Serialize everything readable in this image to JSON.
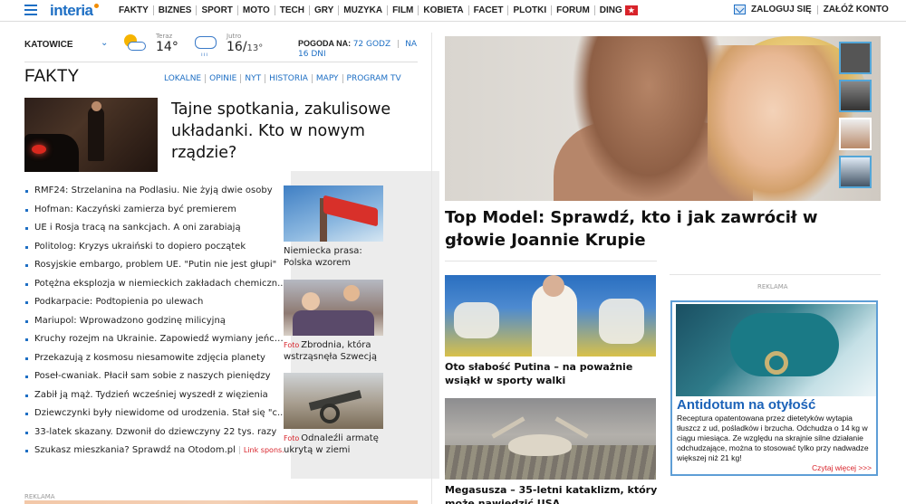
{
  "header": {
    "logo": "interia",
    "nav": [
      "FAKTY",
      "BIZNES",
      "SPORT",
      "MOTO",
      "TECH",
      "GRY",
      "MUZYKA",
      "FILM",
      "KOBIETA",
      "FACET",
      "PLOTKI",
      "FORUM",
      "DING"
    ],
    "login": "ZALOGUJ SIĘ",
    "register": "ZAŁÓŻ KONTO"
  },
  "weather": {
    "city": "KATOWICE",
    "now_label": "Teraz",
    "now_temp": "14°",
    "tomorrow_label": "Jutro",
    "tomorrow_high": "16/",
    "tomorrow_low": "13°",
    "forecast_label": "POGODA NA:",
    "forecast_72": "72 GODZ",
    "forecast_16": "NA 16 DNI"
  },
  "fakty": {
    "title": "FAKTY",
    "subnav": [
      "LOKALNE",
      "OPINIE",
      "NYT",
      "HISTORIA",
      "MAPY",
      "PROGRAM TV"
    ],
    "lead_title": "Tajne spotkania, zakulisowe układanki. Kto w nowym rządzie?",
    "headlines": [
      "RMF24: Strzelanina na Podlasiu. Nie żyją dwie osoby",
      "Hofman: Kaczyński zamierza być premierem",
      "UE i Rosja tracą na sankcjach. A oni zarabiają",
      "Politolog: Kryzys ukraiński to dopiero początek",
      "Rosyjskie embargo, problem UE. \"Putin nie jest głupi\"",
      "Potężna eksplozja w niemieckich zakładach chemiczn...",
      "Podkarpacie: Podtopienia po ulewach",
      "Mariupol: Wprowadzono godzinę milicyjną",
      "Kruchy rozejm na Ukrainie. Zapowiedź wymiany jeńców",
      "Przekazują z kosmosu niesamowite zdjęcia planety",
      "Poseł-cwaniak. Płacił sam sobie z naszych pieniędzy",
      "Zabił ją mąż. Tydzień wcześniej wyszedł z więzienia",
      "Dziewczynki były niewidome od urodzenia. Stał się \"c...",
      "33-latek skazany. Dzwonił do dziewczyny 22 tys. razy"
    ],
    "sponsored": {
      "text": "Szukasz mieszkania? Sprawdź na Otodom.pl",
      "tag": "Link spons."
    },
    "side": [
      {
        "tag": "",
        "caption": "Niemiecka prasa: Polska wzorem"
      },
      {
        "tag": "Foto",
        "caption": "Zbrodnia, która wstrząsnęła Szwecją"
      },
      {
        "tag": "Foto",
        "caption": "Odnaleźli armatę ukrytą w ziemi"
      }
    ]
  },
  "main": {
    "hero_title": "Top Model: Sprawdź, kto i jak zawrócił w głowie Joannie Krupie",
    "stories": [
      {
        "title": "Oto słabość Putina – na poważnie wsiąkł w sporty walki"
      },
      {
        "title": "Megasusza – 35-letni kataklizm, który może nawiedzić USA"
      }
    ]
  },
  "ad": {
    "label": "REKLAMA",
    "title": "Antidotum na otyłość",
    "text": "Receptura opatentowana przez dietetyków wytapia tłuszcz z ud, pośladków i brzucha. Odchudza o 14 kg w ciągu miesiąca. Ze względu na skrajnie silne działanie odchudzające, można to stosować tylko przy nadwadze większej niż 21 kg!",
    "more": "Czytaj więcej >>>"
  },
  "bottom": {
    "reklama": "REKLAMA"
  },
  "colors": {
    "accent": "#1e6fc4",
    "alert": "#d8232a",
    "ad_border": "#5e9ed6"
  }
}
